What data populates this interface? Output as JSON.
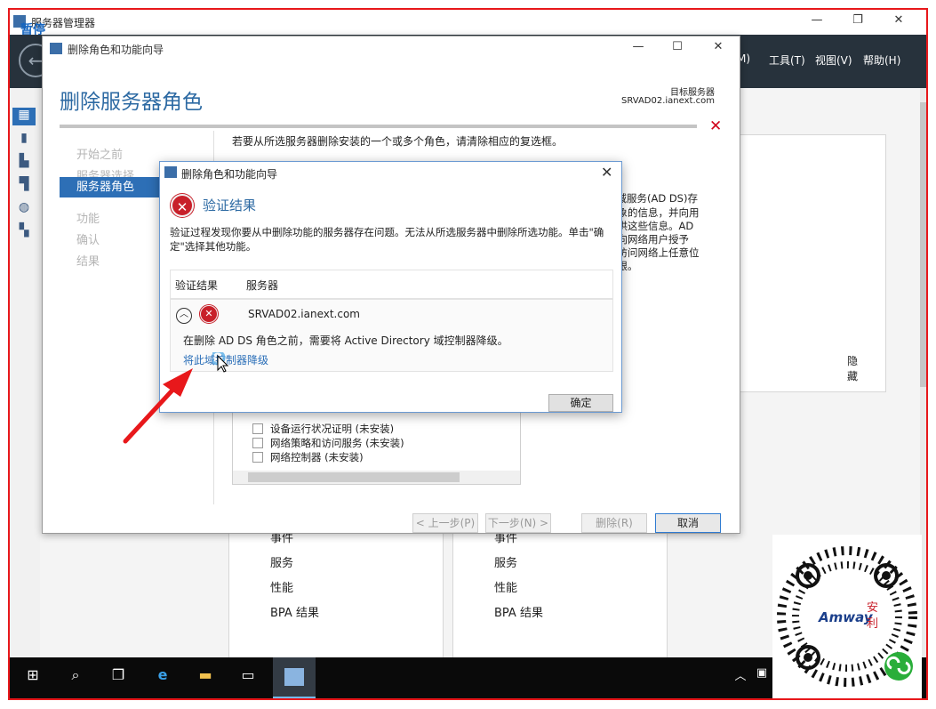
{
  "server_manager": {
    "title": "服务器管理器",
    "pause_label": "暂停",
    "menu": [
      "M)",
      "工具(T)",
      "视图(V)",
      "帮助(H)"
    ],
    "cards": [
      {
        "items": [
          "事件",
          "服务",
          "性能",
          "BPA 结果"
        ]
      },
      {
        "items": [
          "事件",
          "服务",
          "性能",
          "BPA 结果"
        ]
      }
    ]
  },
  "wizard": {
    "title": "删除角色和功能向导",
    "heading": "删除服务器角色",
    "target_label": "目标服务器",
    "target_value": "SRVAD02.ianext.com",
    "steps": [
      "开始之前",
      "服务器选择",
      "服务器角色",
      "功能",
      "确认",
      "结果"
    ],
    "active_step": "服务器角色",
    "intro": "若要从所选服务器删除安装的一个或多个角色，请清除相应的复选框。",
    "description_lines": [
      "y 域服务(AD DS)存",
      "对象的信息，并向用",
      "提供这些信息。AD",
      "，向网络用户授予",
      "过访问网络上任意位",
      "权限。"
    ],
    "hide_label": "隐藏",
    "roles": [
      "设备运行状况证明 (未安装)",
      "网络策略和访问服务 (未安装)",
      "网络控制器 (未安装)"
    ],
    "buttons": {
      "prev": "< 上一步(P)",
      "next": "下一步(N) >",
      "remove": "删除(R)",
      "cancel": "取消"
    }
  },
  "modal": {
    "title": "删除角色和功能向导",
    "heading": "验证结果",
    "description": "验证过程发现你要从中删除功能的服务器存在问题。无法从所选服务器中删除所选功能。单击\"确定\"选择其他功能。",
    "col_result": "验证结果",
    "col_server": "服务器",
    "server": "SRVAD02.ianext.com",
    "message": "在删除 AD DS 角色之前，需要将 Active Directory 域控制器降级。",
    "link": "将此域控制器降级",
    "ok": "确定"
  },
  "colors": {
    "accent": "#2d6fb6",
    "error": "#c8202a",
    "annotation": "#e8181b"
  }
}
